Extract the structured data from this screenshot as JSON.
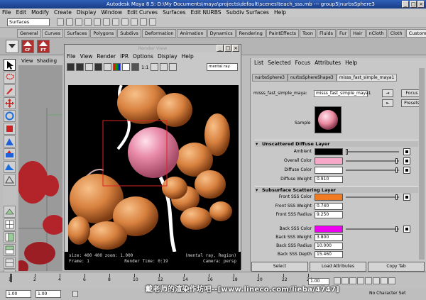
{
  "window": {
    "title": "Autodesk Maya 8.5: D:\\My Documents\\maya\\projects\\default\\scenes\\teach_sss.mb    ---    group5|nurbsSphere3"
  },
  "menu": [
    "File",
    "Edit",
    "Modify",
    "Create",
    "Display",
    "Window",
    "Edit Curves",
    "Surfaces",
    "Edit NURBS",
    "Subdiv Surfaces",
    "Help"
  ],
  "mode": "Surfaces",
  "shelf_tabs": [
    "General",
    "Curves",
    "Surfaces",
    "Polygons",
    "Subdivs",
    "Deformation",
    "Animation",
    "Dynamics",
    "Rendering",
    "PaintEffects",
    "Toon",
    "Fluids",
    "Fur",
    "Hair",
    "nCloth",
    "Cloth",
    "Custom"
  ],
  "active_shelf_tab": "Custom",
  "shelf_buttons": [
    "CF",
    "FT"
  ],
  "viewport_menu": [
    "View",
    "Shading"
  ],
  "render_view": {
    "title": "Render View",
    "menu": [
      "File",
      "View",
      "Render",
      "IPR",
      "Options",
      "Display",
      "Help"
    ],
    "ratio": "1:1",
    "renderer": "mental ray",
    "info_line1_left": "size:  400  400 zoom: 1.000",
    "info_line1_right": "(mental ray, Region)",
    "info_line2_left": "Frame: 1",
    "info_line2_mid": "Render Time: 0:19",
    "info_line2_right": "Camera: persp"
  },
  "attribute_editor": {
    "menu": [
      "List",
      "Selected",
      "Focus",
      "Attributes",
      "Help"
    ],
    "tabs": [
      "nurbsSphere3",
      "nurbsSphereShape3",
      "misss_fast_simple_maya1"
    ],
    "active_tab": "misss_fast_simple_maya1",
    "node_label": "misss_fast_simple_maya:",
    "node_value": "misss_fast_simple_maya1",
    "focus_btn": "Focus",
    "presets_btn": "Presets",
    "sample_label": "Sample",
    "section1": "Unscattered Diffuse Layer",
    "ambient_label": "Ambient",
    "overall_color_label": "Overall Color",
    "diffuse_color_label": "Diffuse Color",
    "diffuse_weight_label": "Diffuse Weight",
    "diffuse_weight": "0.910",
    "section2": "Subsurface Scattering Layer",
    "front_color_label": "Front SSS Color",
    "front_weight_label": "Front SSS Weight",
    "front_weight": "0.740",
    "front_radius_label": "Front SSS Radius",
    "front_radius": "9.250",
    "back_color_label": "Back SSS Color",
    "back_weight_label": "Back SSS Weight",
    "back_weight": "3.800",
    "back_radius_label": "Back SSS Radius",
    "back_radius": "10.000",
    "back_depth_label": "Back SSS Depth",
    "back_depth": "15.460",
    "select_btn": "Select",
    "load_btn": "Load Attributes",
    "copy_btn": "Copy Tab"
  },
  "colors": {
    "ambient": "#000000",
    "overall": "#f5a8c8",
    "diffuse": "#ffffff",
    "front_sss": "#f07a22",
    "back_sss": "#ee00ee"
  },
  "timeline": {
    "ticks": [
      "1",
      "2",
      "4",
      "6",
      "8",
      "10",
      "12",
      "14",
      "16",
      "18",
      "20",
      "22",
      "24"
    ],
    "current_frame": "1.00"
  },
  "range": {
    "start": "1.00",
    "playback_start": "1.00",
    "charset": "No Character Set"
  },
  "watermark": "戴老师的渲染作坊吧--[www.lineco.com/lieba/4747]"
}
